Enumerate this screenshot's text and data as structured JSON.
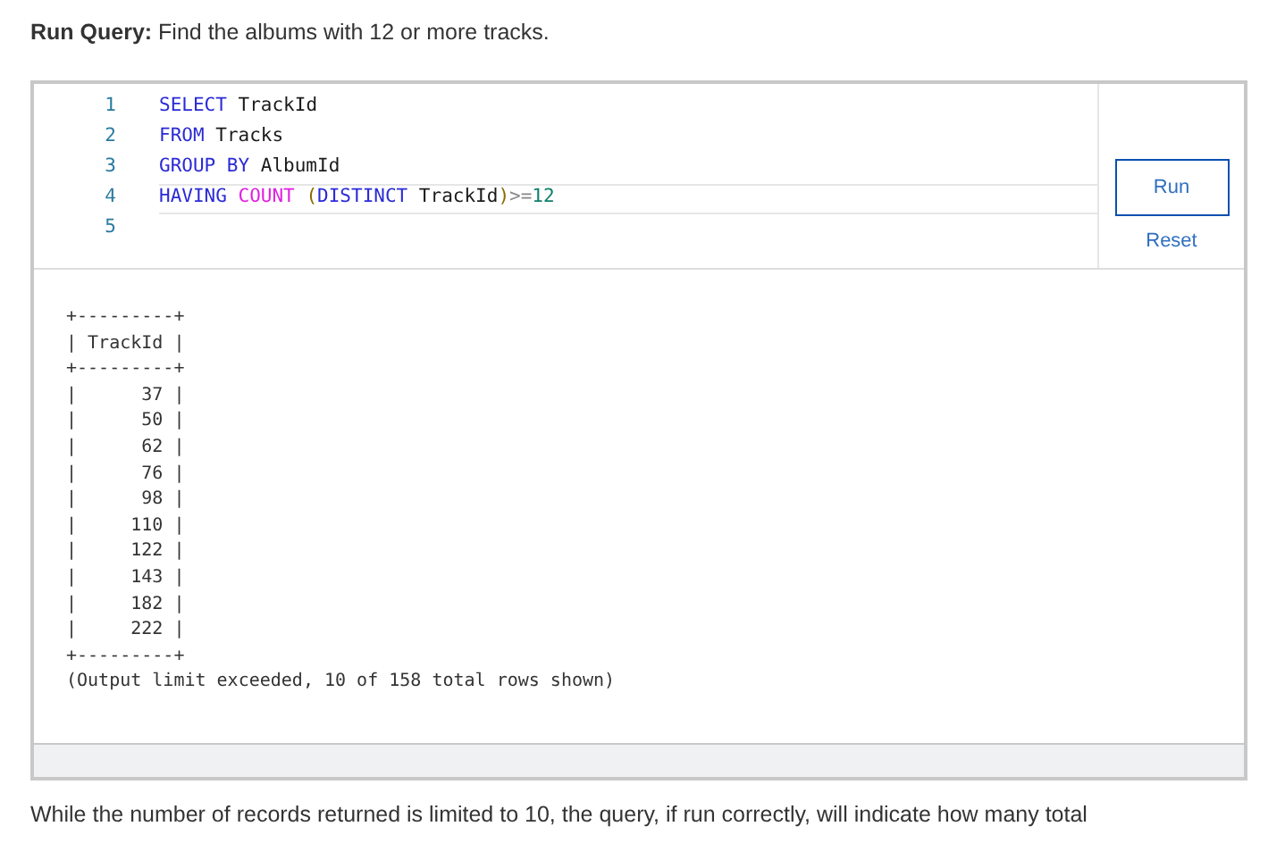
{
  "prompt": {
    "label": "Run Query:",
    "text": "Find the albums with 12 or more tracks."
  },
  "editor": {
    "lines": [
      {
        "number": "1",
        "current": false,
        "tokens": [
          {
            "kind": "keyword",
            "text": "SELECT"
          },
          {
            "kind": "plain",
            "text": " TrackId"
          }
        ]
      },
      {
        "number": "2",
        "current": false,
        "tokens": [
          {
            "kind": "keyword",
            "text": "FROM"
          },
          {
            "kind": "plain",
            "text": " Tracks"
          }
        ]
      },
      {
        "number": "3",
        "current": false,
        "tokens": [
          {
            "kind": "keyword",
            "text": "GROUP BY"
          },
          {
            "kind": "plain",
            "text": " AlbumId"
          }
        ]
      },
      {
        "number": "4",
        "current": true,
        "tokens": [
          {
            "kind": "keyword",
            "text": "HAVING"
          },
          {
            "kind": "function",
            "text": " COUNT"
          },
          {
            "kind": "bracket",
            "text": " ("
          },
          {
            "kind": "keyword",
            "text": "DISTINCT"
          },
          {
            "kind": "plain",
            "text": " TrackId"
          },
          {
            "kind": "bracket",
            "text": ")"
          },
          {
            "kind": "operator",
            "text": ">="
          },
          {
            "kind": "number",
            "text": "12"
          }
        ]
      },
      {
        "number": "5",
        "current": false
      }
    ]
  },
  "buttons": {
    "run": "Run",
    "reset": "Reset"
  },
  "output": {
    "lines": [
      "+---------+",
      "| TrackId |",
      "+---------+",
      "|      37 |",
      "|      50 |",
      "|      62 |",
      "|      76 |",
      "|      98 |",
      "|     110 |",
      "|     122 |",
      "|     143 |",
      "|     182 |",
      "|     222 |",
      "+---------+",
      "(Output limit exceeded, 10 of 158 total rows shown)"
    ]
  },
  "footer_text": "While the number of records returned is limited to 10, the query, if run correctly, will indicate how many total"
}
